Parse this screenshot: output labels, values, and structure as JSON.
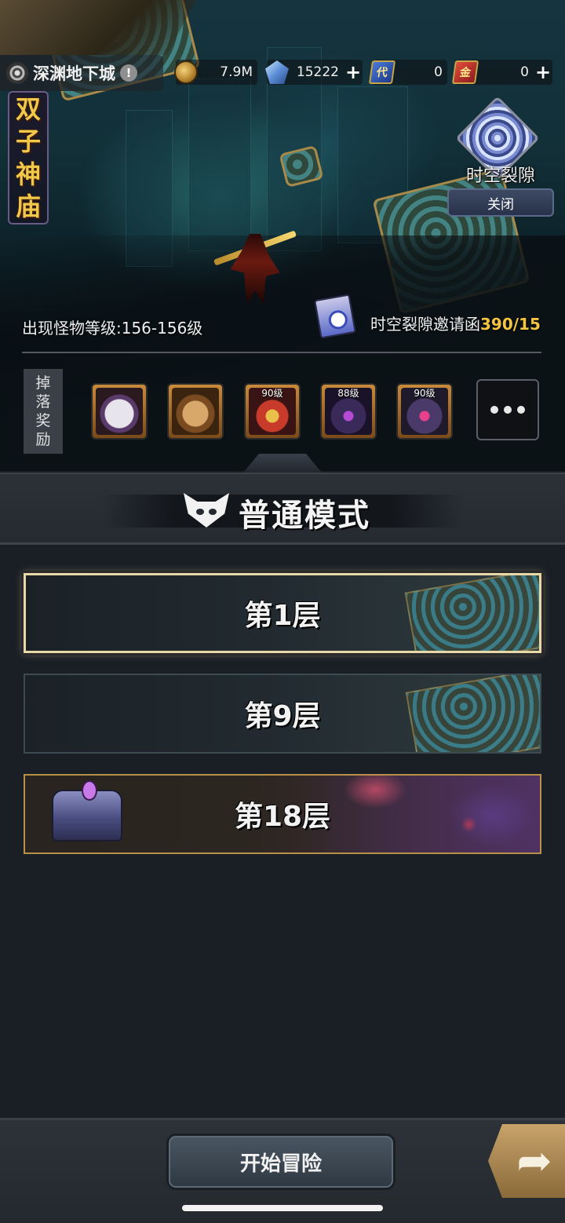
{
  "location": {
    "name": "深渊地下城",
    "alert": "!"
  },
  "resources": {
    "gold": "7.9M",
    "crystal": "15222",
    "crystal_plus": "+",
    "ticket_blue_value": "0",
    "ticket_blue_glyph": "代",
    "ticket_red_value": "0",
    "ticket_red_glyph": "金",
    "ticket_red_plus": "+"
  },
  "dungeon_logo": [
    "双",
    "子",
    "神",
    "庙"
  ],
  "rift": {
    "title": "时空裂隙",
    "close_label": "关闭"
  },
  "monster_level": "出现怪物等级:156-156级",
  "invitation": {
    "label": "时空裂隙邀请函",
    "count": "390/15"
  },
  "rewards": {
    "label_chars": [
      "掉",
      "落",
      "奖",
      "励"
    ],
    "items": [
      {
        "name": "rabbit-mask",
        "level": ""
      },
      {
        "name": "tiki-mask",
        "level": ""
      },
      {
        "name": "red-gauntlet",
        "level": "90级"
      },
      {
        "name": "dark-helm",
        "level": "88级"
      },
      {
        "name": "dark-armor",
        "level": "90级"
      }
    ]
  },
  "mode": {
    "title": "普通模式"
  },
  "floors": [
    {
      "label": "第1层",
      "selected": true
    },
    {
      "label": "第9层",
      "selected": false
    },
    {
      "label": "第18层",
      "boss": true
    }
  ],
  "start_button": "开始冒险",
  "colors": {
    "invite_count": "#f5c542",
    "logo_gold": "#f0c84a",
    "selected_border": "#e8d8a8"
  }
}
